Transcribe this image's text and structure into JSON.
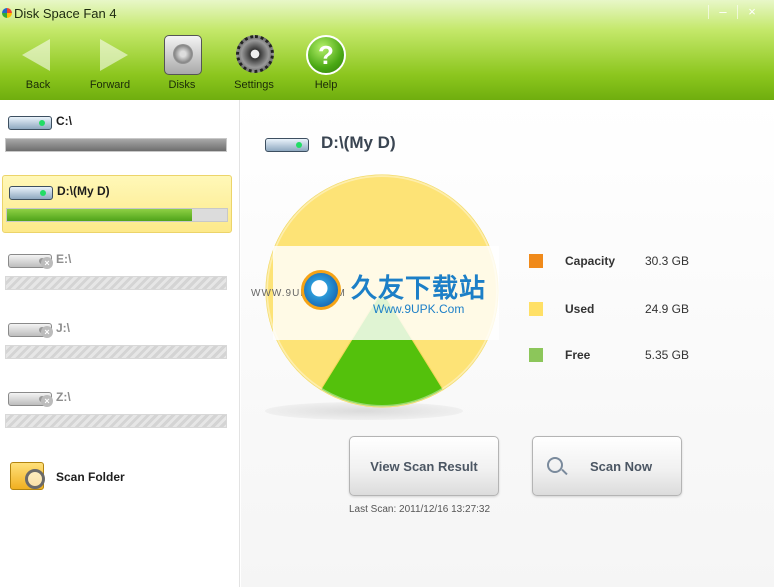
{
  "window": {
    "title": "Disk Space Fan 4",
    "controls": [
      "|",
      "–",
      "×"
    ]
  },
  "toolbar": {
    "back_label": "Back",
    "forward_label": "Forward",
    "disks_label": "Disks",
    "settings_label": "Settings",
    "help_label": "Help"
  },
  "sidebar": {
    "drives": [
      {
        "name": "C:\\",
        "used_fraction": 1.0,
        "available": true,
        "selected": false
      },
      {
        "name": "D:\\(My D)",
        "used_fraction": 0.84,
        "available": true,
        "selected": true
      },
      {
        "name": "E:\\",
        "used_fraction": 0,
        "available": false,
        "selected": false
      },
      {
        "name": "J:\\",
        "used_fraction": 0,
        "available": false,
        "selected": false
      },
      {
        "name": "Z:\\",
        "used_fraction": 0,
        "available": false,
        "selected": false
      }
    ],
    "scan_folder_label": "Scan Folder"
  },
  "main": {
    "drive_title": "D:\\(My D)",
    "legend": [
      {
        "label": "Capacity",
        "value": "30.3 GB",
        "color": "#f08a1a"
      },
      {
        "label": "Used",
        "value": "24.9 GB",
        "color": "#ffe066"
      },
      {
        "label": "Free",
        "value": "5.35 GB",
        "color": "#8cc65a"
      }
    ],
    "view_scan_label": "View Scan Result",
    "scan_now_label": "Scan Now",
    "last_scan": "Last Scan: 2011/12/16 13:27:32"
  },
  "chart_data": {
    "type": "pie",
    "categories": [
      "Used",
      "Free"
    ],
    "values": [
      24.9,
      5.35
    ],
    "colors": [
      "#fde376",
      "#54c10c"
    ]
  },
  "watermark": {
    "logo_text": "久友下载站",
    "url_text": "Www.9UPK.Com",
    "side_text": "WWW.9UPK.COM"
  },
  "colors": {
    "accent_green": "#8cc61e",
    "selection_yellow": "#fde98a"
  }
}
